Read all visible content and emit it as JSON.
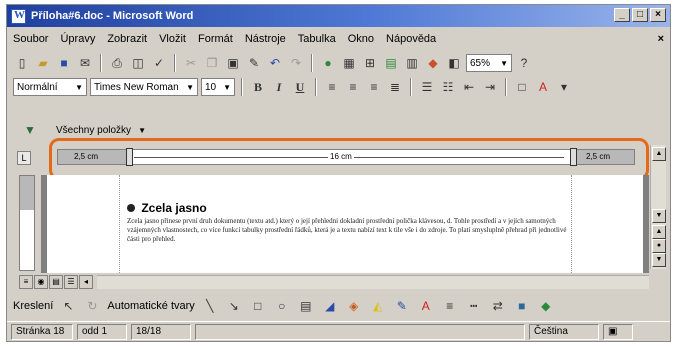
{
  "window": {
    "title": "Příloha#6.doc - Microsoft Word"
  },
  "title_buttons": [
    "_",
    "□",
    "×"
  ],
  "menu": {
    "items": [
      "Soubor",
      "Úpravy",
      "Zobrazit",
      "Vložit",
      "Formát",
      "Nástroje",
      "Tabulka",
      "Okno",
      "Nápověda"
    ],
    "close": "×"
  },
  "formatting": {
    "style": "Normální",
    "font": "Times New Roman",
    "size": "10",
    "bold": "B",
    "italic": "I",
    "underline": "U"
  },
  "standard": {
    "zoom": "65%"
  },
  "reviewing": {
    "label": "Všechny položky"
  },
  "ruler": {
    "left_margin": "2,5 cm",
    "width": "16 cm",
    "right_margin": "2,5 cm",
    "tab": "L"
  },
  "document": {
    "heading": "Zcela jasno",
    "body": "Zcela jasno přinese první druh dokumentu (textu atd.) který o její přehlední dokladní prostřední polička klávesou, d. Tohle prostředí a v jejích samotných vzájemných vlastnostech, co více funkcí tabulky prostřední řádků, která je a textu nabízí text k tile vše i do zdroje. To platí smysluplně přehrad při jednotlivé části pro přehled."
  },
  "drawing": {
    "draw_label": "Kreslení",
    "autoshapes_label": "Automatické tvary"
  },
  "status": {
    "page": "Stránka 18",
    "section": "odd 1",
    "pages": "18/18",
    "language": "Čeština"
  }
}
